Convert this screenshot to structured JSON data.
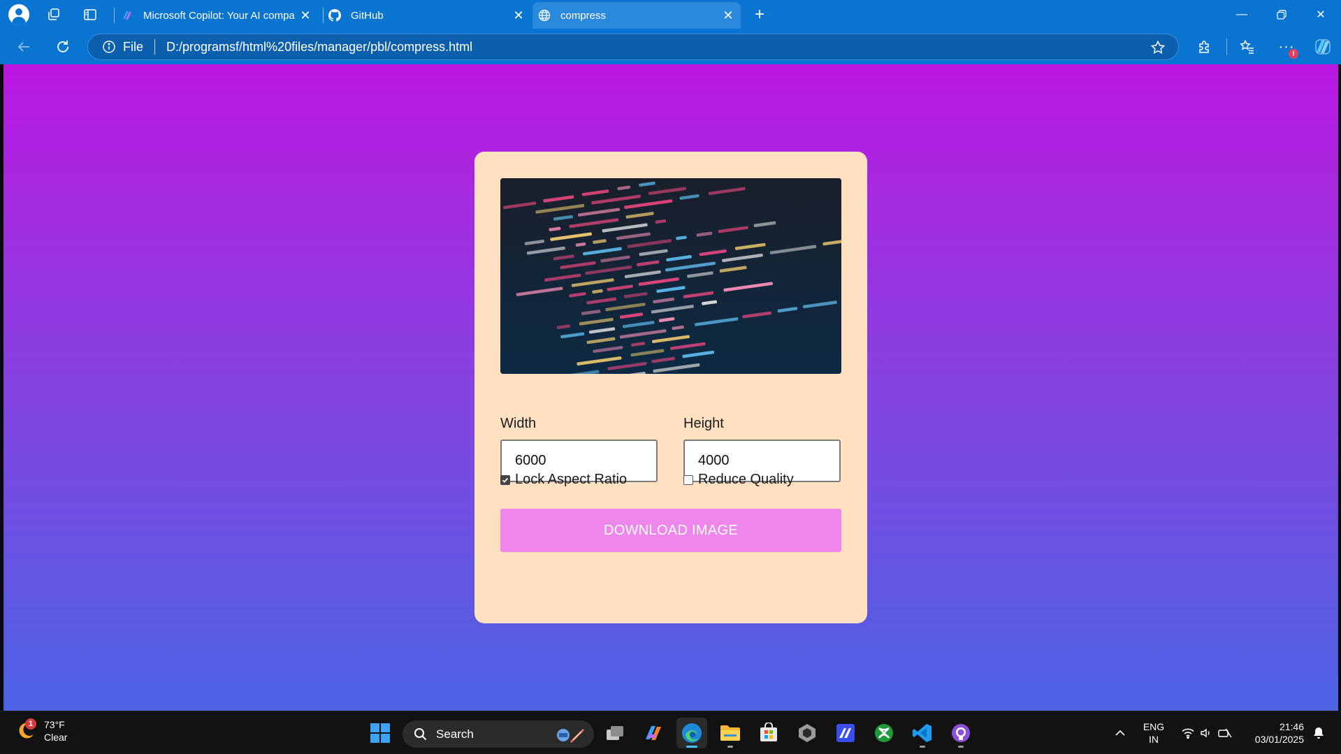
{
  "browser": {
    "tabs": [
      {
        "title": "Microsoft Copilot: Your AI compa",
        "icon": "copilot-icon",
        "active": false
      },
      {
        "title": "GitHub",
        "icon": "github-icon",
        "active": false
      },
      {
        "title": "compress",
        "icon": "globe-icon",
        "active": true
      }
    ],
    "address": {
      "scheme_label": "File",
      "url": "D:/programsf/html%20files/manager/pbl/compress.html"
    }
  },
  "page": {
    "preview_icon": "code-screenshot-image",
    "width": {
      "label": "Width",
      "value": "6000"
    },
    "height": {
      "label": "Height",
      "value": "4000"
    },
    "lock_aspect": {
      "label": "Lock Aspect Ratio",
      "checked": true
    },
    "reduce_quality": {
      "label": "Reduce Quality",
      "checked": false
    },
    "download_label": "DOWNLOAD IMAGE",
    "colors": {
      "gradient_top": "#bb17e1",
      "gradient_bottom": "#4b62e3",
      "card": "#ffe1c2",
      "button": "#ee86ec"
    }
  },
  "taskbar": {
    "weather": {
      "badge": "1",
      "temp": "73°F",
      "condition": "Clear"
    },
    "search_label": "Search",
    "apps": [
      "task-view-icon",
      "copilot-icon",
      "edge-icon",
      "file-explorer-icon",
      "store-icon",
      "app-icon",
      "app-icon",
      "xbox-icon",
      "vscode-icon",
      "github-desktop-icon"
    ],
    "language": {
      "line1": "ENG",
      "line2": "IN"
    },
    "time": "21:46",
    "date": "03/01/2025"
  }
}
